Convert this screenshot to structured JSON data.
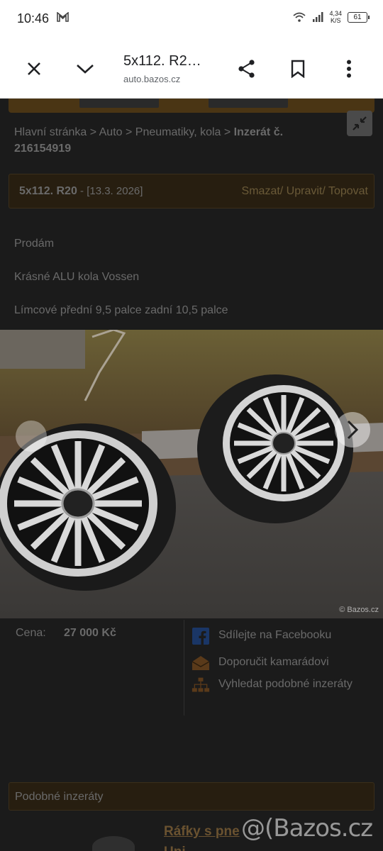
{
  "status": {
    "time": "10:46",
    "net_speed_value": "4,34",
    "net_speed_unit": "K/S",
    "battery": "61"
  },
  "browser": {
    "tab_title": "5x112. R2…",
    "url": "auto.bazos.cz",
    "icons": [
      "close-icon",
      "chevron-down-icon",
      "share-icon",
      "bookmark-icon",
      "more-vert-icon"
    ]
  },
  "breadcrumb": {
    "home": "Hlavní stránka",
    "sep": " > ",
    "auto": "Auto",
    "category": "Pneumatiky, kola",
    "current": "Inzerát č. 216154919"
  },
  "ad": {
    "title": "5x112. R20",
    "date": " - [13.3. 2026]",
    "actions": "Smazat/ Upravit/ Topovat",
    "description": [
      "Prodám",
      "Krásné ALU kola Vossen",
      "Límcové přední 9,5 palce zadní 10,5 palce"
    ],
    "photo_watermark": "© Bazos.cz",
    "price_label": "Cena:",
    "price": "27 000 Kč"
  },
  "share": {
    "facebook": "Sdílejte na Facebooku",
    "recommend": "Doporučit kamarádovi",
    "similar": "Vyhledat podobné inzeráty"
  },
  "similar_section": {
    "heading": "Podobné inzeráty",
    "link_line1": "Ráfky s pne",
    "link_line2": "Uni"
  },
  "page_watermark": "@(Bazos.cz",
  "colors": {
    "page_bg": "#1b1b1b",
    "bar_bg": "#271e10",
    "facebook": "#1a4a8a"
  }
}
